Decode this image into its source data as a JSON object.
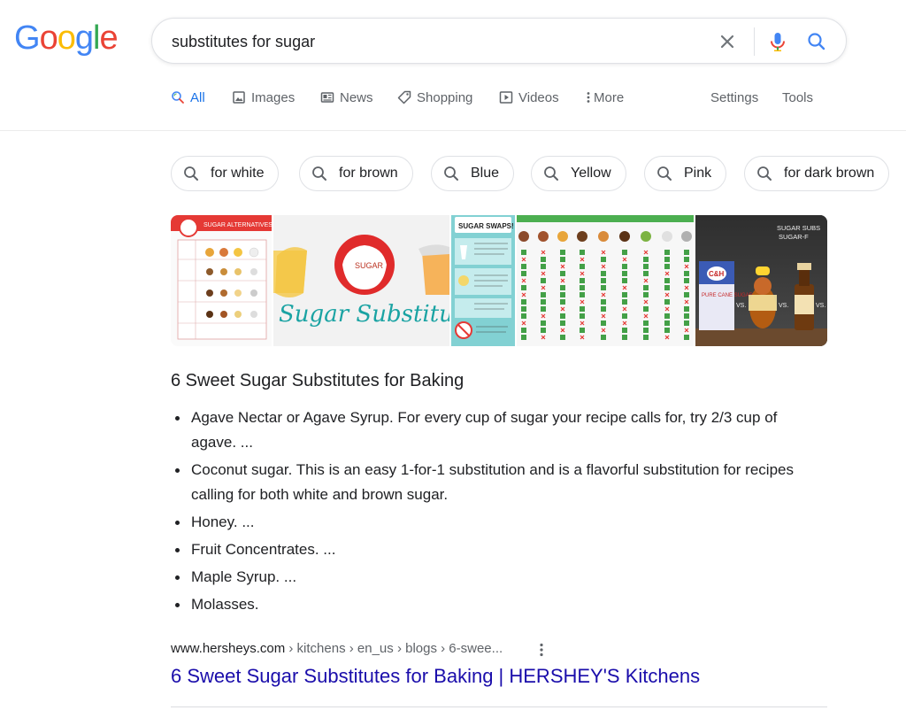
{
  "logo": {
    "letters": [
      "G",
      "o",
      "o",
      "g",
      "l",
      "e"
    ],
    "colors": [
      "#4285f4",
      "#ea4335",
      "#fbbc05",
      "#4285f4",
      "#34a853",
      "#ea4335"
    ]
  },
  "search": {
    "query": "substitutes for sugar"
  },
  "tabs": {
    "all": "All",
    "images": "Images",
    "news": "News",
    "shopping": "Shopping",
    "videos": "Videos",
    "more": "More",
    "settings": "Settings",
    "tools": "Tools"
  },
  "chips": [
    "for white",
    "for brown",
    "Blue",
    "Yellow",
    "Pink",
    "for dark brown"
  ],
  "images": {
    "thumb1": {
      "title": "SUGAR ALTERNATIVES"
    },
    "thumb2": {
      "label": "SUGAR",
      "caption": "Sugar Substitute"
    },
    "thumb3": {
      "title": "SUGAR SWAPS!"
    },
    "thumb4": {},
    "thumb5": {
      "title": "SUGAR SUBS\nSUGAR-F",
      "brand": "C&H",
      "product": "PURE CANE SUGAR",
      "vs": "VS."
    }
  },
  "snippet": {
    "title": "6 Sweet Sugar Substitutes for Baking",
    "items": [
      "Agave Nectar or Agave Syrup. For every cup of sugar your recipe calls for, try 2/3 cup of agave. ...",
      "Coconut sugar. This is an easy 1-for-1 substitution and is a flavorful substitution for recipes calling for both white and brown sugar.",
      "Honey. ...",
      "Fruit Concentrates. ...",
      "Maple Syrup. ...",
      "Molasses."
    ]
  },
  "result": {
    "domain": "www.hersheys.com",
    "breadcrumbs": " › kitchens › en_us › blogs › 6-swee...",
    "title": "6 Sweet Sugar Substitutes for Baking | HERSHEY'S Kitchens"
  },
  "colors": {
    "link": "#1a0dab",
    "accent": "#1a73e8",
    "secondary_text": "#5f6368"
  }
}
